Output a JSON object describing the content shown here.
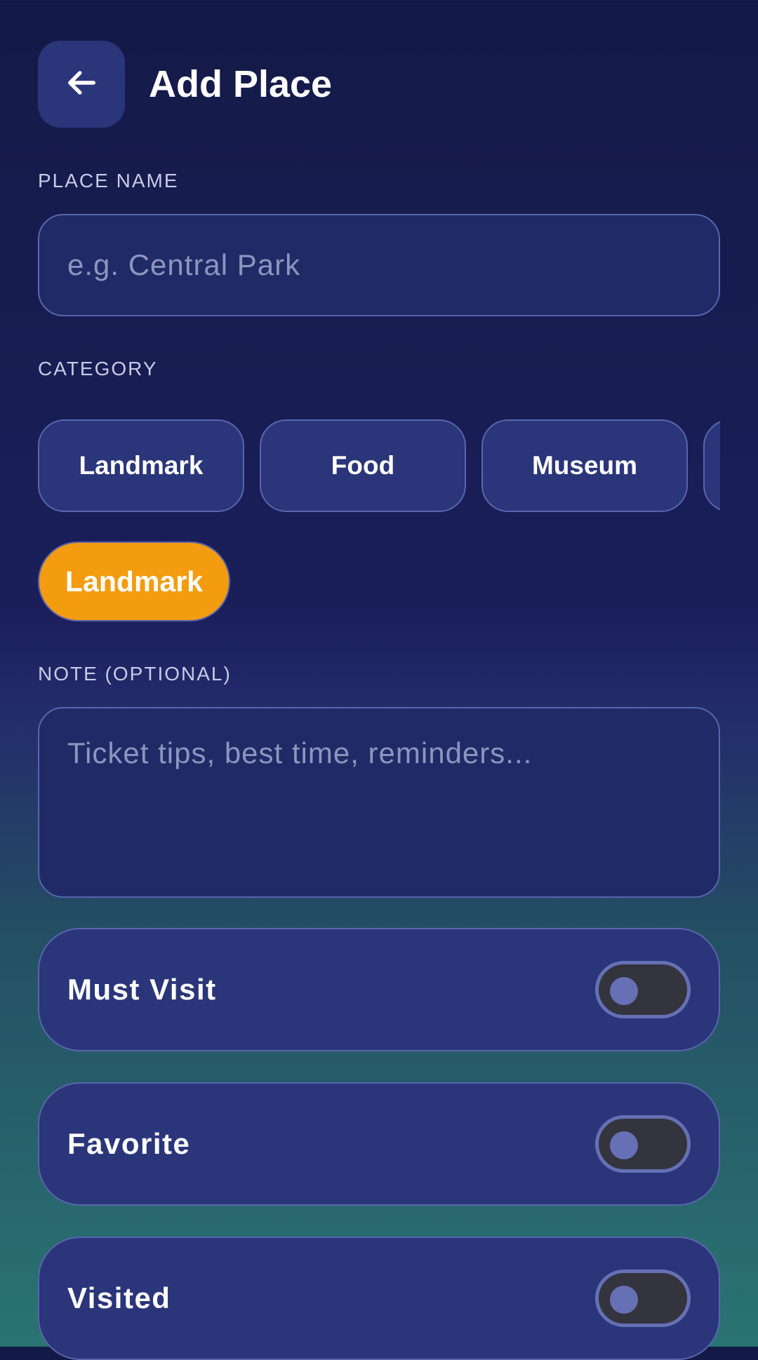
{
  "header": {
    "back_icon": "arrow-left-icon",
    "title": "Add Place"
  },
  "place_name": {
    "label": "PLACE NAME",
    "value": "",
    "placeholder": "e.g. Central Park"
  },
  "category": {
    "label": "CATEGORY",
    "chips": [
      "Landmark",
      "Food",
      "Museum",
      ""
    ],
    "selected": "Landmark",
    "selected_color": "#f39c0f"
  },
  "note": {
    "label": "NOTE (OPTIONAL)",
    "value": "",
    "placeholder": "Ticket tips, best time, reminders..."
  },
  "toggles": [
    {
      "label": "Must Visit",
      "on": false
    },
    {
      "label": "Favorite",
      "on": false
    },
    {
      "label": "Visited",
      "on": false
    }
  ]
}
